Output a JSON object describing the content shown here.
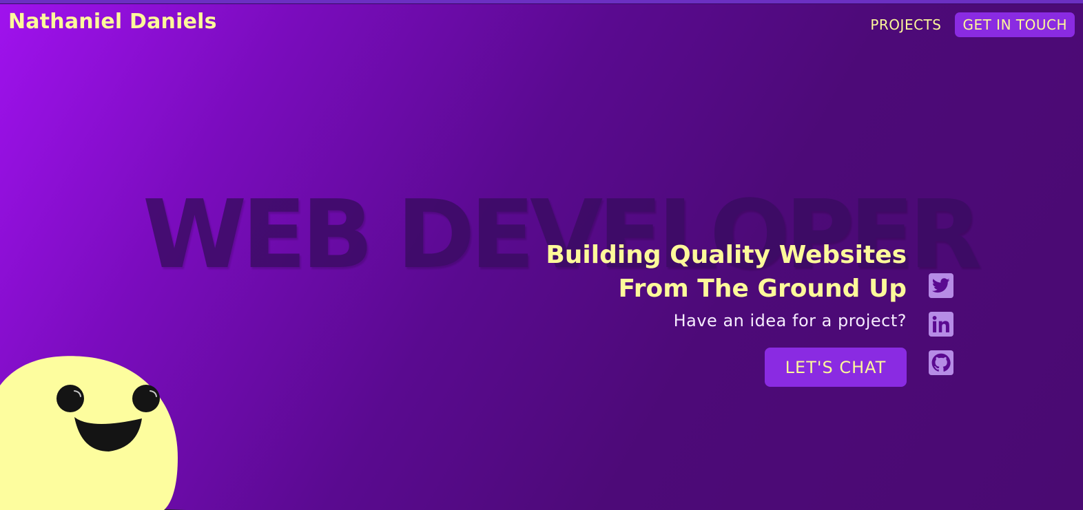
{
  "header": {
    "brand": "Nathaniel Daniels",
    "nav": {
      "projects": "PROJECTS",
      "contact": "GET IN TOUCH"
    }
  },
  "hero": {
    "background_word": "WEB DEVELOPER",
    "headline_line1": "Building Quality Websites",
    "headline_line2": "From The Ground Up",
    "tagline": "Have an idea for a project?",
    "cta": "LET'S CHAT"
  },
  "social": [
    {
      "icon": "twitter-icon"
    },
    {
      "icon": "linkedin-icon"
    },
    {
      "icon": "github-icon"
    }
  ],
  "colors": {
    "accent_yellow": "#fdf99a",
    "accent_purple": "#8a2be2",
    "social_bg": "#b68ce6",
    "background_start": "#a012ee",
    "background_end": "#4a0a72"
  }
}
